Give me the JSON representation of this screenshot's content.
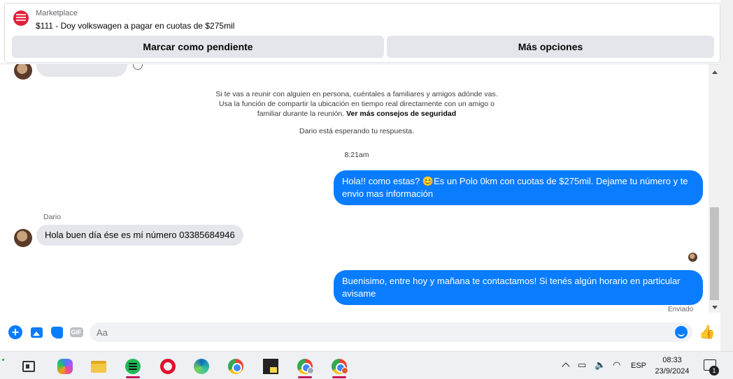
{
  "header": {
    "source_label": "Marketplace",
    "listing_title": "$111 - Doy volkswagen a pagar en cuotas de $275mil",
    "mark_pending_label": "Marcar como pendiente",
    "more_options_label": "Más opciones"
  },
  "chat": {
    "safety_notice": "Si te vas a reunir con alguien en persona, cuéntales a familiares y amigos adónde vas. Usa la función de compartir la ubicación en tiempo real directamente con un amigo o familiar durante la reunión.",
    "safety_link": "Ver más consejos de seguridad",
    "waiting_text": "Dario está esperando tu respuesta.",
    "timestamp": "8:21am",
    "messages": [
      {
        "direction": "out",
        "text": "Hola!! como estas? 😊Es un Polo 0km con cuotas de $275mil. Dejame tu número y te envio mas información"
      },
      {
        "direction": "in",
        "sender": "Dario",
        "text": "Hola buen día ése es mí número 03385684946"
      },
      {
        "direction": "out",
        "text": "Buenisimo, entre hoy y mañana te contactamos! Si tenés algún horario en particular avisame",
        "status": "Enviado"
      }
    ]
  },
  "composer": {
    "placeholder": "Aa",
    "icons": [
      "plus-icon",
      "image-icon",
      "sticker-icon",
      "gif-icon",
      "emoji-icon",
      "thumbs-up-icon"
    ],
    "gif_label": "GIF"
  },
  "taskbar": {
    "apps": [
      "widgets",
      "copilot",
      "file-explorer",
      "spotify",
      "opera",
      "edge",
      "chrome",
      "sticky-notes",
      "chrome-profile-1",
      "chrome-profile-2"
    ],
    "language": "ESP",
    "time": "08:33",
    "date": "23/9/2024",
    "notification_count": "1"
  },
  "colors": {
    "accent": "#0a7cff",
    "bubble_incoming": "#e4e6eb",
    "button_bg": "#e4e6eb"
  }
}
